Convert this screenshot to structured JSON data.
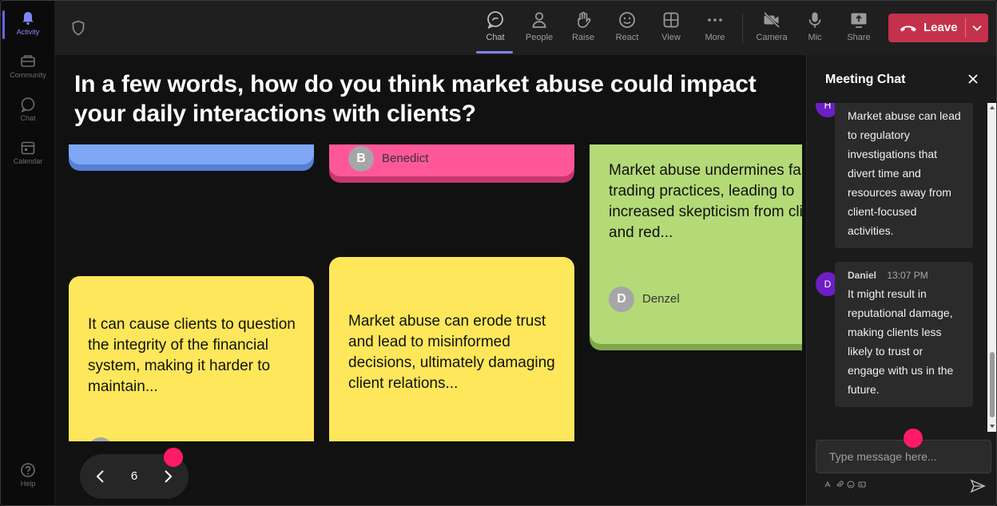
{
  "rail": {
    "items": [
      {
        "label": "Activity",
        "icon": "bell-icon",
        "active": true
      },
      {
        "label": "Community",
        "icon": "community-icon",
        "active": false
      },
      {
        "label": "Chat",
        "icon": "chat-icon",
        "active": false
      },
      {
        "label": "Calendar",
        "icon": "calendar-icon",
        "active": false
      },
      {
        "label": "Help",
        "icon": "help-icon",
        "active": false
      }
    ]
  },
  "toolbar": {
    "chat": "Chat",
    "people": "People",
    "raise": "Raise",
    "react": "React",
    "view": "View",
    "more": "More",
    "camera": "Camera",
    "mic": "Mic",
    "share": "Share",
    "leave": "Leave"
  },
  "stage": {
    "question": "In a few words, how do you think market abuse could impact your daily interactions with clients?",
    "notes": {
      "pink": {
        "avatar": "B",
        "author": "Benedict"
      },
      "green": {
        "text": "Market abuse undermines fair trading practices, leading to increased skepticism from clients and red...",
        "avatar": "D",
        "author": "Denzel"
      },
      "yellow1": {
        "text": "It can cause clients to question the integrity of the financial system, making it harder to maintain..."
      },
      "yellow2": {
        "text": "Market abuse can erode trust and lead to misinformed decisions, ultimately damaging client relations..."
      }
    },
    "pager": {
      "page": "6"
    }
  },
  "chat": {
    "title": "Meeting Chat",
    "messages": [
      {
        "avatar": "H",
        "author": "",
        "time": "",
        "text": "Market abuse can lead to regulatory investigations that divert time and resources away from client-focused activities."
      },
      {
        "avatar": "D",
        "author": "Daniel",
        "time": "13:07 PM",
        "text": "It might result in reputational damage, making clients less likely to trust or engage with us in the future."
      }
    ],
    "input_placeholder": "Type message here..."
  },
  "colors": {
    "accent": "#7f85f5",
    "leave": "#c4314b",
    "note_blue": "#7ea8f5",
    "note_pink": "#ff5899",
    "note_green": "#b3da76",
    "note_yellow": "#fee75a",
    "marker": "#ff1a66",
    "avatar_purple": "#6b1fc4"
  }
}
